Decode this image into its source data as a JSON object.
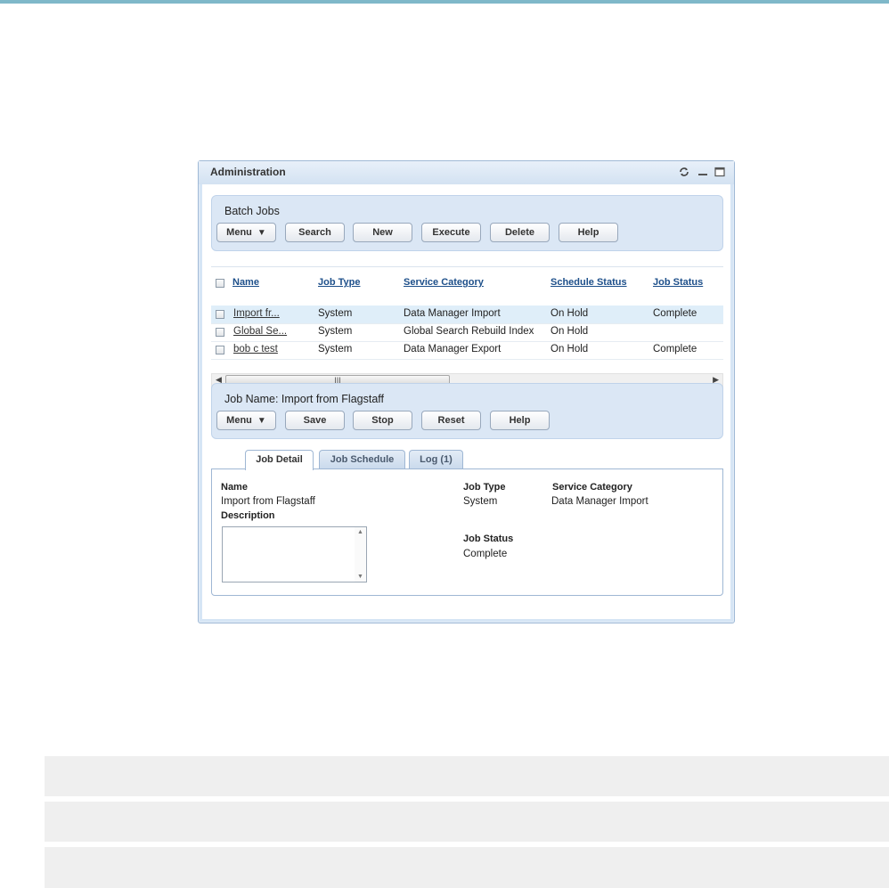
{
  "portlet": {
    "title": "Administration"
  },
  "batch_jobs": {
    "title": "Batch Jobs",
    "buttons": {
      "menu": "Menu",
      "search": "Search",
      "new": "New",
      "execute": "Execute",
      "delete": "Delete",
      "help": "Help"
    }
  },
  "grid": {
    "columns": [
      "Name",
      "Job Type",
      "Service Category",
      "Schedule Status",
      "Job Status"
    ],
    "rows": [
      {
        "name": "Import fr...",
        "job_type": "System",
        "service_category": "Data Manager Import",
        "schedule_status": "On Hold",
        "job_status": "Complete",
        "selected": true
      },
      {
        "name": "Global Se...",
        "job_type": "System",
        "service_category": "Global Search Rebuild Index",
        "schedule_status": "On Hold",
        "job_status": "",
        "selected": false
      },
      {
        "name": "bob c test",
        "job_type": "System",
        "service_category": "Data Manager Export",
        "schedule_status": "On Hold",
        "job_status": "Complete",
        "selected": false
      }
    ],
    "scroll_thumb": "III"
  },
  "job_panel": {
    "title": "Job Name: Import from Flagstaff",
    "buttons": {
      "menu": "Menu",
      "save": "Save",
      "stop": "Stop",
      "reset": "Reset",
      "help": "Help"
    }
  },
  "tabs": [
    "Job Detail",
    "Job Schedule",
    "Log (1)"
  ],
  "detail": {
    "name_label": "Name",
    "name_value": "Import from Flagstaff",
    "description_label": "Description",
    "description_value": "",
    "job_type_label": "Job Type",
    "job_type_value": "System",
    "service_category_label": "Service Category",
    "service_category_value": "Data Manager Import",
    "job_status_label": "Job Status",
    "job_status_value": "Complete"
  },
  "icons": {
    "refresh": "refresh-icon",
    "minimize": "minimize-icon",
    "maximize": "maximize-icon"
  },
  "colors": {
    "link": "#1d4f8a",
    "panel": "#dbe7f5",
    "selected_row": "#dfeef9",
    "top_accent": "#7fb8c9"
  }
}
